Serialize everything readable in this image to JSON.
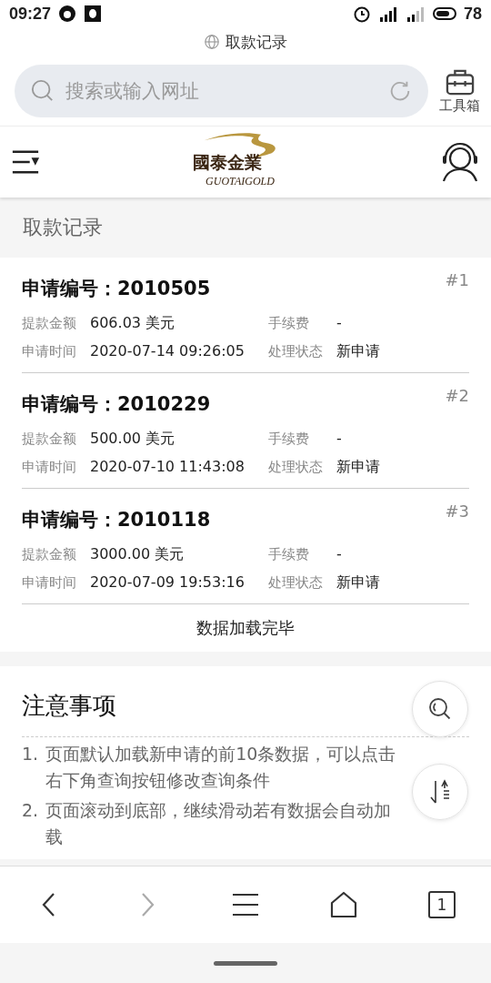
{
  "status_bar": {
    "time": "09:27",
    "battery": "78"
  },
  "browser": {
    "page_title": "取款记录",
    "search": {
      "placeholder": "搜索或输入网址"
    },
    "toolbox_label": "工具箱"
  },
  "site_header": {
    "logo_text": "國泰金業",
    "logo_subtext": "GUOTAIGOLD"
  },
  "page_heading": "取款记录",
  "records": [
    {
      "title": "申请编号：2010505",
      "index": "#1",
      "amount_label": "提款金额",
      "amount": "606.03 美元",
      "fee_label": "手续费",
      "fee": "-",
      "time_label": "申请时间",
      "time": "2020-07-14 09:26:05",
      "status_label": "处理状态",
      "status": "新申请"
    },
    {
      "title": "申请编号：2010229",
      "index": "#2",
      "amount_label": "提款金额",
      "amount": "500.00 美元",
      "fee_label": "手续费",
      "fee": "-",
      "time_label": "申请时间",
      "time": "2020-07-10 11:43:08",
      "status_label": "处理状态",
      "status": "新申请"
    },
    {
      "title": "申请编号：2010118",
      "index": "#3",
      "amount_label": "提款金额",
      "amount": "3000.00 美元",
      "fee_label": "手续费",
      "fee": "-",
      "time_label": "申请时间",
      "time": "2020-07-09 19:53:16",
      "status_label": "处理状态",
      "status": "新申请"
    }
  ],
  "load_complete": "数据加载完毕",
  "notes": {
    "title": "注意事项",
    "items": [
      {
        "number": "1.",
        "text": "页面默认加载新申请的前10条数据，可以点击右下角查询按钮修改查询条件"
      },
      {
        "number": "2.",
        "text": "页面滚动到底部，继续滑动若有数据会自动加载"
      }
    ]
  },
  "bottom_nav": {
    "back_disabled": false,
    "forward_disabled": true,
    "tab_count": "1"
  }
}
